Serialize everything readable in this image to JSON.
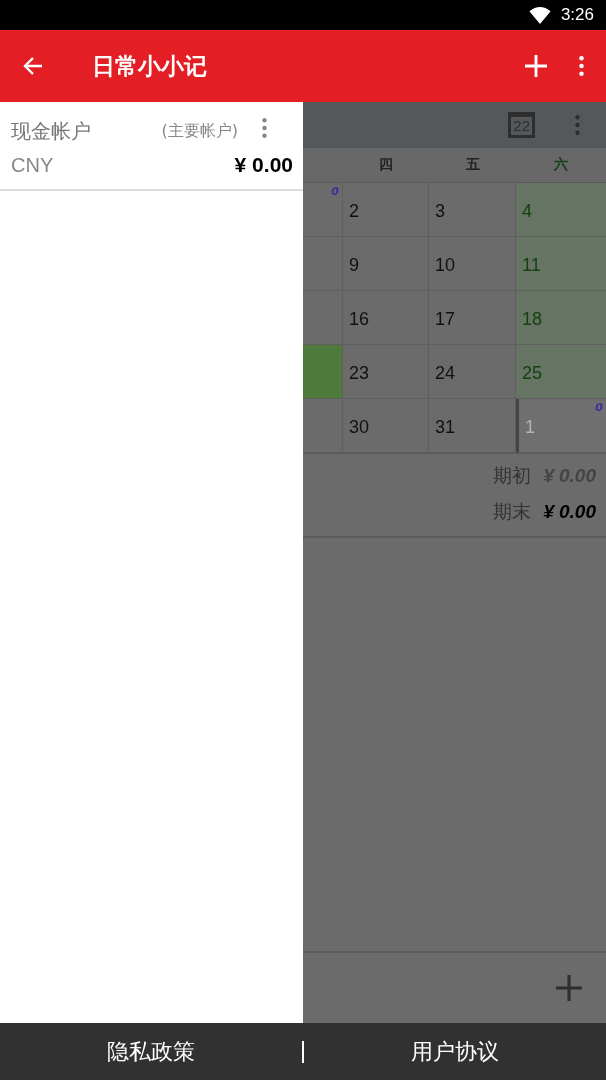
{
  "status_bar": {
    "time": "3:26"
  },
  "app_bar": {
    "title": "日常小小记"
  },
  "drawer": {
    "accounts": [
      {
        "name": "现金帐户",
        "tag": "(主要帐户)",
        "currency": "CNY",
        "balance": "¥ 0.00"
      }
    ]
  },
  "calendar": {
    "date_button": "22",
    "weekdays": [
      {
        "label": "四",
        "weekend": false
      },
      {
        "label": "五",
        "weekend": false
      },
      {
        "label": "六",
        "weekend": true
      }
    ],
    "rows": [
      {
        "lead": {
          "badge": "0",
          "today": false
        },
        "days": [
          {
            "label": "2",
            "weekend": false,
            "outside": false
          },
          {
            "label": "3",
            "weekend": false,
            "outside": false
          },
          {
            "label": "4",
            "weekend": true,
            "outside": false
          }
        ]
      },
      {
        "lead": {
          "today": false
        },
        "days": [
          {
            "label": "9",
            "weekend": false,
            "outside": false
          },
          {
            "label": "10",
            "weekend": false,
            "outside": false
          },
          {
            "label": "11",
            "weekend": true,
            "outside": false
          }
        ]
      },
      {
        "lead": {
          "today": false
        },
        "days": [
          {
            "label": "16",
            "weekend": false,
            "outside": false
          },
          {
            "label": "17",
            "weekend": false,
            "outside": false
          },
          {
            "label": "18",
            "weekend": true,
            "outside": false
          }
        ]
      },
      {
        "lead": {
          "today": true
        },
        "days": [
          {
            "label": "23",
            "weekend": false,
            "outside": false
          },
          {
            "label": "24",
            "weekend": false,
            "outside": false
          },
          {
            "label": "25",
            "weekend": true,
            "outside": false
          }
        ]
      },
      {
        "lead": {
          "today": false
        },
        "days": [
          {
            "label": "30",
            "weekend": false,
            "outside": false
          },
          {
            "label": "31",
            "weekend": false,
            "outside": false
          },
          {
            "label": "1",
            "weekend": true,
            "outside": true,
            "badge": "0"
          }
        ]
      }
    ],
    "summary": [
      {
        "kind": "opening",
        "label": "期初",
        "value": "¥ 0.00"
      },
      {
        "kind": "closing",
        "label": "期末",
        "value": "¥ 0.00"
      }
    ]
  },
  "footer": {
    "links": [
      "隐私政策",
      "用户协议"
    ]
  }
}
